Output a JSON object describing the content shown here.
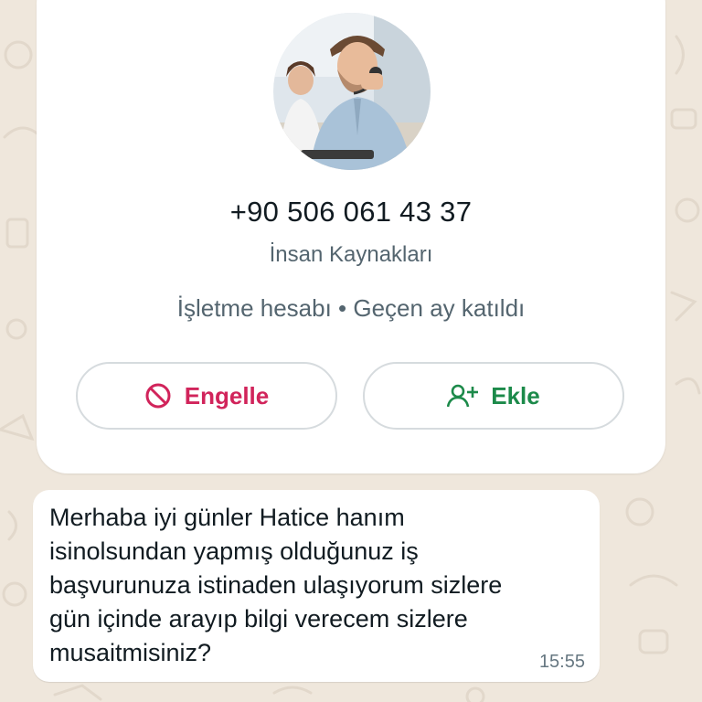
{
  "contact": {
    "phone": "+90 506 061 43 37",
    "about": "İnsan Kaynakları",
    "meta": "İşletme hesabı • Geçen ay katıldı"
  },
  "actions": {
    "block_label": "Engelle",
    "add_label": "Ekle",
    "block_icon": "block-icon",
    "add_icon": "add-contact-icon"
  },
  "message": {
    "text": "Merhaba iyi günler Hatice  hanım\nisinolsundan yapmış olduğunuz iş\nbaşvurunuza istinaden ulaşıyorum sizlere\ngün içinde arayıp bilgi verecem sizlere\nmusaitmisiniz?",
    "time": "15:55"
  },
  "colors": {
    "block": "#d1245b",
    "add": "#1c8a4a",
    "background": "#efe7dc"
  }
}
